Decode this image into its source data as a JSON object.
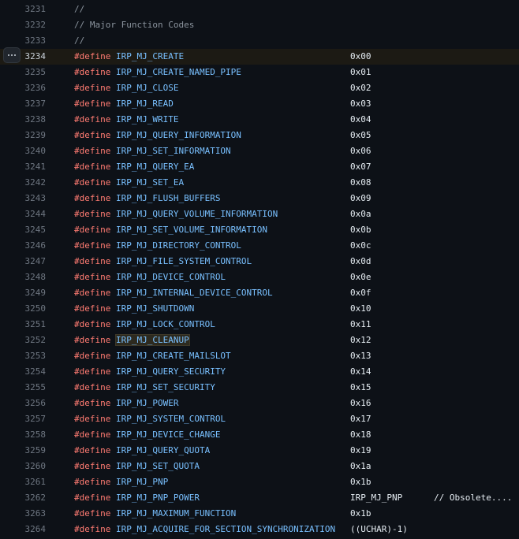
{
  "comment_lines": [
    {
      "number": "3231",
      "text": "//"
    },
    {
      "number": "3232",
      "text": "// Major Function Codes"
    },
    {
      "number": "3233",
      "text": "//"
    }
  ],
  "define_keyword": "#define",
  "defines": [
    {
      "number": "3234",
      "name": "IRP_MJ_CREATE",
      "value": "0x00"
    },
    {
      "number": "3235",
      "name": "IRP_MJ_CREATE_NAMED_PIPE",
      "value": "0x01"
    },
    {
      "number": "3236",
      "name": "IRP_MJ_CLOSE",
      "value": "0x02"
    },
    {
      "number": "3237",
      "name": "IRP_MJ_READ",
      "value": "0x03"
    },
    {
      "number": "3238",
      "name": "IRP_MJ_WRITE",
      "value": "0x04"
    },
    {
      "number": "3239",
      "name": "IRP_MJ_QUERY_INFORMATION",
      "value": "0x05"
    },
    {
      "number": "3240",
      "name": "IRP_MJ_SET_INFORMATION",
      "value": "0x06"
    },
    {
      "number": "3241",
      "name": "IRP_MJ_QUERY_EA",
      "value": "0x07"
    },
    {
      "number": "3242",
      "name": "IRP_MJ_SET_EA",
      "value": "0x08"
    },
    {
      "number": "3243",
      "name": "IRP_MJ_FLUSH_BUFFERS",
      "value": "0x09"
    },
    {
      "number": "3244",
      "name": "IRP_MJ_QUERY_VOLUME_INFORMATION",
      "value": "0x0a"
    },
    {
      "number": "3245",
      "name": "IRP_MJ_SET_VOLUME_INFORMATION",
      "value": "0x0b"
    },
    {
      "number": "3246",
      "name": "IRP_MJ_DIRECTORY_CONTROL",
      "value": "0x0c"
    },
    {
      "number": "3247",
      "name": "IRP_MJ_FILE_SYSTEM_CONTROL",
      "value": "0x0d"
    },
    {
      "number": "3248",
      "name": "IRP_MJ_DEVICE_CONTROL",
      "value": "0x0e"
    },
    {
      "number": "3249",
      "name": "IRP_MJ_INTERNAL_DEVICE_CONTROL",
      "value": "0x0f"
    },
    {
      "number": "3250",
      "name": "IRP_MJ_SHUTDOWN",
      "value": "0x10"
    },
    {
      "number": "3251",
      "name": "IRP_MJ_LOCK_CONTROL",
      "value": "0x11"
    },
    {
      "number": "3252",
      "name": "IRP_MJ_CLEANUP",
      "value": "0x12"
    },
    {
      "number": "3253",
      "name": "IRP_MJ_CREATE_MAILSLOT",
      "value": "0x13"
    },
    {
      "number": "3254",
      "name": "IRP_MJ_QUERY_SECURITY",
      "value": "0x14"
    },
    {
      "number": "3255",
      "name": "IRP_MJ_SET_SECURITY",
      "value": "0x15"
    },
    {
      "number": "3256",
      "name": "IRP_MJ_POWER",
      "value": "0x16"
    },
    {
      "number": "3257",
      "name": "IRP_MJ_SYSTEM_CONTROL",
      "value": "0x17"
    },
    {
      "number": "3258",
      "name": "IRP_MJ_DEVICE_CHANGE",
      "value": "0x18"
    },
    {
      "number": "3259",
      "name": "IRP_MJ_QUERY_QUOTA",
      "value": "0x19"
    },
    {
      "number": "3260",
      "name": "IRP_MJ_SET_QUOTA",
      "value": "0x1a"
    },
    {
      "number": "3261",
      "name": "IRP_MJ_PNP",
      "value": "0x1b"
    },
    {
      "number": "3262",
      "name": "IRP_MJ_PNP_POWER",
      "value": "IRP_MJ_PNP",
      "trailing": "// Obsolete...."
    },
    {
      "number": "3263",
      "name": "IRP_MJ_MAXIMUM_FUNCTION",
      "value": "0x1b"
    },
    {
      "number": "3264",
      "name": "IRP_MJ_ACQUIRE_FOR_SECTION_SYNCHRONIZATION",
      "value": "((UCHAR)-1)"
    }
  ],
  "active_line": "3234",
  "highlighted_symbol": "IRP_MJ_CLEANUP",
  "line_actions_icon": "kebab-horizontal-icon",
  "colors": {
    "background": "#0d1117",
    "line_number": "#6e7681",
    "comment": "#8b949e",
    "keyword": "#ff7b72",
    "constant": "#79c0ff",
    "text": "#e6edf3",
    "active_line_bg": "#1c1a14"
  }
}
